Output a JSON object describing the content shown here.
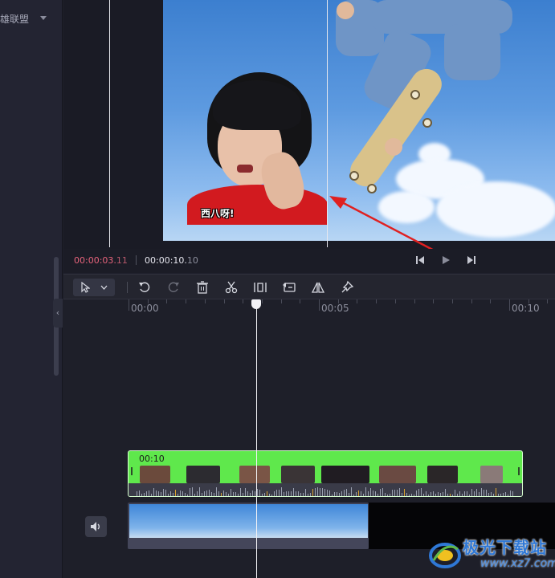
{
  "sidebar": {
    "item_label": "雄联盟",
    "collapse_glyph": "‹"
  },
  "preview": {
    "subtitle": "西八呀!"
  },
  "time": {
    "current_main": "00:00:03.",
    "current_frac": "11",
    "total_main": "00:00:10.",
    "total_frac": "10"
  },
  "ruler": {
    "labels": [
      "00:00",
      "00:05",
      "00:10"
    ]
  },
  "clip": {
    "duration": "00:10"
  },
  "watermark": {
    "name": "极光下载站",
    "url": "www.xz7.com"
  },
  "colors": {
    "accent_time": "#e8647c",
    "green_clip": "#5fe84c",
    "annotation_arrow": "#e02020"
  }
}
